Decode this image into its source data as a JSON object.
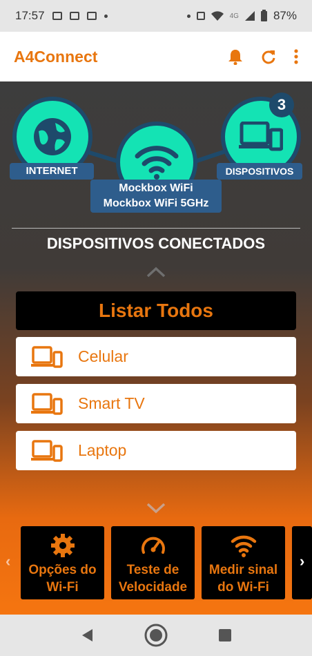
{
  "status_bar": {
    "time": "17:57",
    "battery": "87%",
    "network": "4G"
  },
  "app_bar": {
    "title": "A4Connect",
    "icons": [
      "bell-icon",
      "refresh-icon",
      "more-vert-icon"
    ]
  },
  "network": {
    "internet_label": "INTERNET",
    "devices_label": "DISPOSITIVOS",
    "devices_count": "3",
    "wifi_name_1": "Mockbox WiFi",
    "wifi_name_2": "Mockbox WiFi 5GHz"
  },
  "section_title": "DISPOSITIVOS CONECTADOS",
  "list_all_label": "Listar Todos",
  "devices": [
    {
      "name": "Celular"
    },
    {
      "name": "Smart TV"
    },
    {
      "name": "Laptop"
    }
  ],
  "tools": [
    {
      "line1": "Opções do",
      "line2": "Wi-Fi",
      "icon": "gear-icon"
    },
    {
      "line1": "Teste de",
      "line2": "Velocidade",
      "icon": "speedometer-icon"
    },
    {
      "line1": "Medir sinal",
      "line2": "do Wi-Fi",
      "icon": "wifi-icon"
    }
  ],
  "colors": {
    "accent": "#e8760f",
    "node": "#14e3b4",
    "node_border": "#1e4a6b",
    "label_bg": "#2e5d8c"
  }
}
